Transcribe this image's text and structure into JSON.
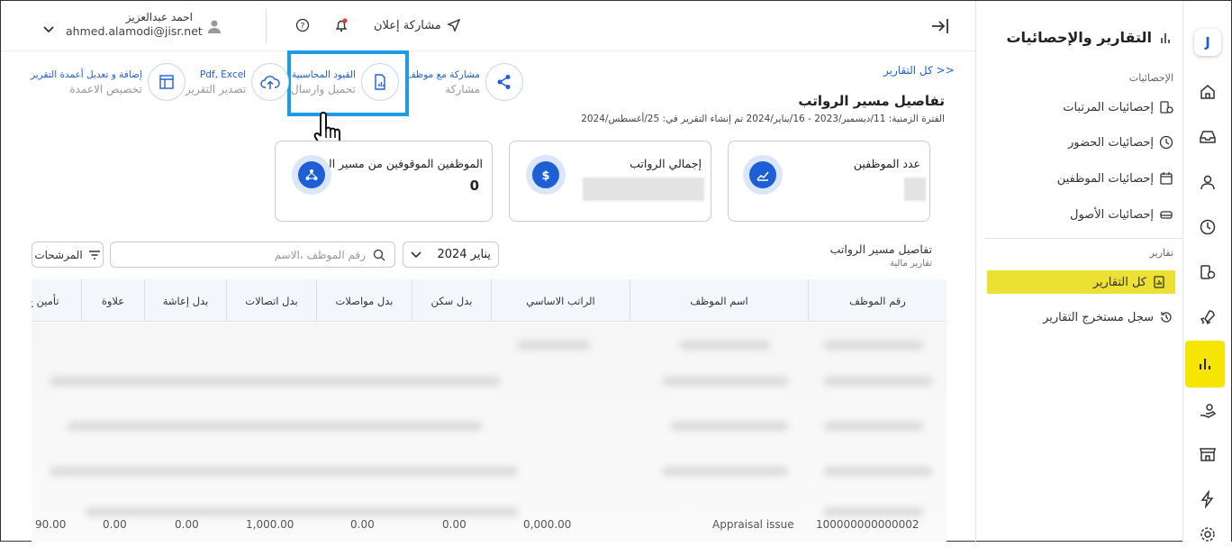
{
  "header": {
    "user_name": "احمد عبدالعزيز",
    "user_email": "ahmed.alamodi@jisr.net",
    "share_announcement": "مشاركة إعلان"
  },
  "toolbar": {
    "share": {
      "label": "مشاركة مع موظف",
      "sub": "مشاركة"
    },
    "accounting": {
      "label": "القيود المحاسبية",
      "sub": "تحميل وارسال"
    },
    "export": {
      "label": "Pdf, Excel",
      "sub": "تصدير التقرير"
    },
    "columns": {
      "label": "إضافة و تعديل أعمدة التقرير",
      "sub": "تخصيص الاعمدة"
    }
  },
  "breadcrumb": "<< كل التقارير",
  "report": {
    "title": "تفاصيل مسير الرواتب",
    "period": "الفترة الزمنية: 11/ديسمبر/2023 - 16/يناير/2024 تم إنشاء التقرير في: 25/أغسطس/2024"
  },
  "cards": [
    {
      "label": "عدد الموظفين",
      "value": ""
    },
    {
      "label": "إجمالي الرواتب",
      "value": ""
    },
    {
      "label": "الموظفين الموقوفين من مسير الرواتب",
      "value": "0"
    }
  ],
  "filters": {
    "section_title": "تفاصيل مسير الرواتب",
    "section_sub": "تقارير مالية",
    "month": "يناير 2024",
    "search_placeholder": "رقم الموظف ،الاسم",
    "filters_label": "المرشحات"
  },
  "table": {
    "columns": [
      "رقم الموظف",
      "اسم الموظف",
      "الراتب الاساسي",
      "بدل سكن",
      "بدل مواصلات",
      "بدل اتصالات",
      "بدل إعاشة",
      "علاوة",
      "تأمين ع"
    ],
    "last_row": [
      "100000000000002",
      "Appraisal issue",
      "0,000.00",
      "0.00",
      "0.00",
      "1,000.00",
      "0.00",
      "0.00",
      "90.00"
    ]
  },
  "sidebar": {
    "title": "التقارير والإحصائيات",
    "stats_section": "الإحصائيات",
    "stats_items": [
      "إحصائيات المرتبات",
      "إحصائيات الحضور",
      "إحصائيات الموظفين",
      "إحصائيات الأصول"
    ],
    "reports_section": "تقارير",
    "report_items": [
      "كل التقارير",
      "سجل مستخرج التقارير"
    ]
  },
  "rail": {
    "logo": "J"
  },
  "colors": {
    "accent": "#1f5fd6",
    "active": "#ece133",
    "highlight": "#1c9be6"
  }
}
